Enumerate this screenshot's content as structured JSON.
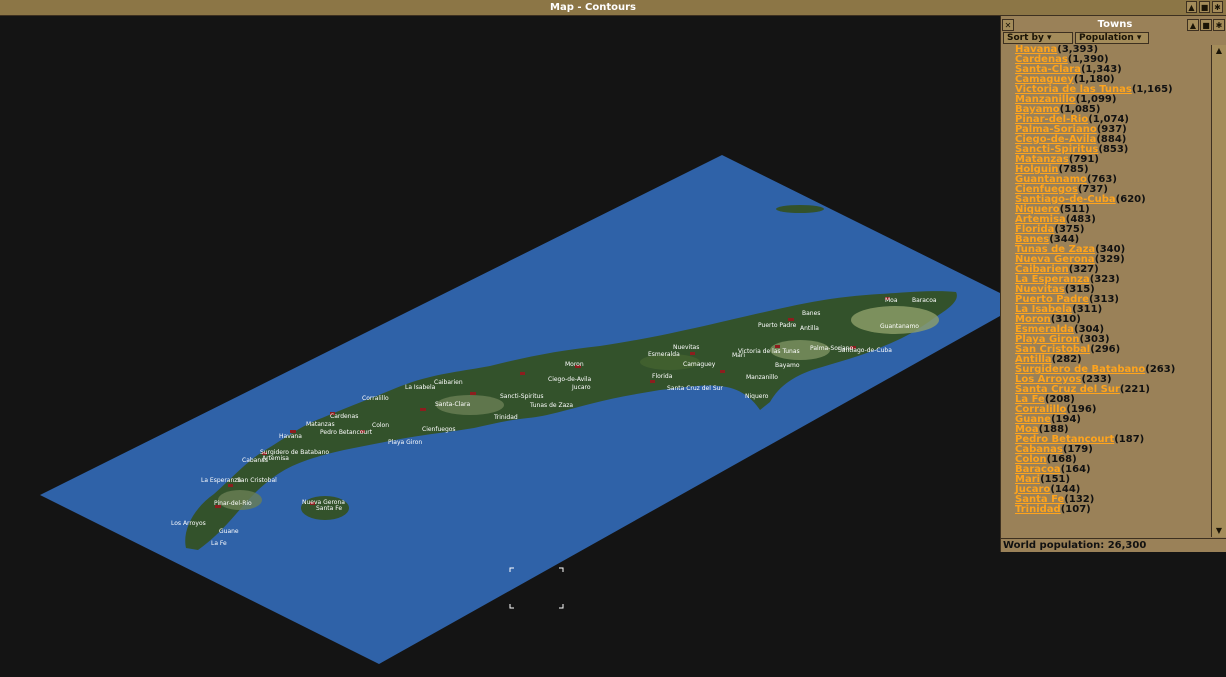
{
  "window": {
    "title": "Map - Contours",
    "btn_collapse": "▲",
    "btn_stick": "■",
    "btn_pin": "✱"
  },
  "panel": {
    "title": "Towns",
    "close": "✕",
    "sort_by_label": "Sort by",
    "sort_value": "Population",
    "btn_collapse": "▲",
    "btn_pin": "✱",
    "scroll_up": "▲",
    "scroll_down": "▼",
    "world_population": "World population: 26,300",
    "towns": [
      {
        "name": "Havana",
        "pop": "(3,393)"
      },
      {
        "name": "Cardenas",
        "pop": "(1,390)"
      },
      {
        "name": "Santa-Clara",
        "pop": "(1,343)"
      },
      {
        "name": "Camaguey",
        "pop": "(1,180)"
      },
      {
        "name": "Victoria de las Tunas",
        "pop": "(1,165)"
      },
      {
        "name": "Manzanillo",
        "pop": "(1,099)"
      },
      {
        "name": "Bayamo",
        "pop": "(1,085)"
      },
      {
        "name": "Pinar-del-Rio",
        "pop": "(1,074)"
      },
      {
        "name": "Palma-Soriano",
        "pop": "(937)"
      },
      {
        "name": "Ciego-de-Avila",
        "pop": "(884)"
      },
      {
        "name": "Sancti-Spiritus",
        "pop": "(853)"
      },
      {
        "name": "Matanzas",
        "pop": "(791)"
      },
      {
        "name": "Holguin",
        "pop": "(785)"
      },
      {
        "name": "Guantanamo",
        "pop": "(763)"
      },
      {
        "name": "Cienfuegos",
        "pop": "(737)"
      },
      {
        "name": "Santiago-de-Cuba",
        "pop": "(620)"
      },
      {
        "name": "Niquero",
        "pop": "(511)"
      },
      {
        "name": "Artemisa",
        "pop": "(483)"
      },
      {
        "name": "Florida",
        "pop": "(375)"
      },
      {
        "name": "Banes",
        "pop": "(344)"
      },
      {
        "name": "Tunas de Zaza",
        "pop": "(340)"
      },
      {
        "name": "Nueva Gerona",
        "pop": "(329)"
      },
      {
        "name": "Caibarien",
        "pop": "(327)"
      },
      {
        "name": "La Esperanza",
        "pop": "(323)"
      },
      {
        "name": "Nuevitas",
        "pop": "(315)"
      },
      {
        "name": "Puerto Padre",
        "pop": "(313)"
      },
      {
        "name": "La Isabela",
        "pop": "(311)"
      },
      {
        "name": "Moron",
        "pop": "(310)"
      },
      {
        "name": "Esmeralda",
        "pop": "(304)"
      },
      {
        "name": "Playa Giron",
        "pop": "(303)"
      },
      {
        "name": "San Cristobal",
        "pop": "(296)"
      },
      {
        "name": "Antilla",
        "pop": "(282)"
      },
      {
        "name": "Surgidero de Batabano",
        "pop": "(263)"
      },
      {
        "name": "Los Arroyos",
        "pop": "(233)"
      },
      {
        "name": "Santa Cruz del Sur",
        "pop": "(221)"
      },
      {
        "name": "La Fe",
        "pop": "(208)"
      },
      {
        "name": "Corralillo",
        "pop": "(196)"
      },
      {
        "name": "Guane",
        "pop": "(194)"
      },
      {
        "name": "Moa",
        "pop": "(188)"
      },
      {
        "name": "Pedro Betancourt",
        "pop": "(187)"
      },
      {
        "name": "Cabanas",
        "pop": "(179)"
      },
      {
        "name": "Colon",
        "pop": "(168)"
      },
      {
        "name": "Baracoa",
        "pop": "(164)"
      },
      {
        "name": "Mari",
        "pop": "(151)"
      },
      {
        "name": "Jucaro",
        "pop": "(144)"
      },
      {
        "name": "Santa Fe",
        "pop": "(132)"
      },
      {
        "name": "Trinidad",
        "pop": "(107)"
      }
    ]
  },
  "map": {
    "colors": {
      "background": "#141414",
      "ocean": "#2f62a8",
      "land": "#33522b",
      "hills": "#8ea06a",
      "town": "#8c1e1e"
    },
    "labels": {
      "moa": "Moa",
      "baracoa": "Baracoa",
      "banes": "Banes",
      "puerto_padre": "Puerto Padre",
      "antilla": "Antilla",
      "guantanamo": "Guantanamo",
      "nuevitas": "Nuevitas",
      "victoria": "Victoria de las Tunas",
      "palma": "Palma-Soriano",
      "santiago": "Santiago-de-Cuba",
      "esmeralda": "Esmeralda",
      "mari": "Mari",
      "moron": "Moron",
      "camaguey": "Camaguey",
      "bayamo": "Bayamo",
      "caibarien": "Caibarien",
      "la_isabela": "La Isabela",
      "ciego": "Ciego-de-Avila",
      "jucaro": "Jucaro",
      "florida": "Florida",
      "manzanillo": "Manzanillo",
      "santa_cruz": "Santa Cruz del Sur",
      "niquero": "Niquero",
      "corralillo": "Corralillo",
      "sancti": "Sancti-Spiritus",
      "tunas_zaza": "Tunas de Zaza",
      "santa_clara": "Santa-Clara",
      "trinidad": "Trinidad",
      "cardenas": "Cardenas",
      "matanzas": "Matanzas",
      "colon": "Colon",
      "cienfuegos": "Cienfuegos",
      "havana": "Havana",
      "pedro": "Pedro Betancourt",
      "playa_giron": "Playa Giron",
      "surgidero": "Surgidero de Batabano",
      "artemisa": "Artemisa",
      "cabanas": "Cabanas",
      "la_esperanza": "La Esperanza",
      "san_cristobal": "San Cristobal",
      "pinar": "Pinar-del-Rio",
      "nueva_gerona": "Nueva Gerona",
      "santa_fe": "Santa Fe",
      "los_arroyos": "Los Arroyos",
      "guane": "Guane",
      "la_fe": "La Fe"
    }
  }
}
